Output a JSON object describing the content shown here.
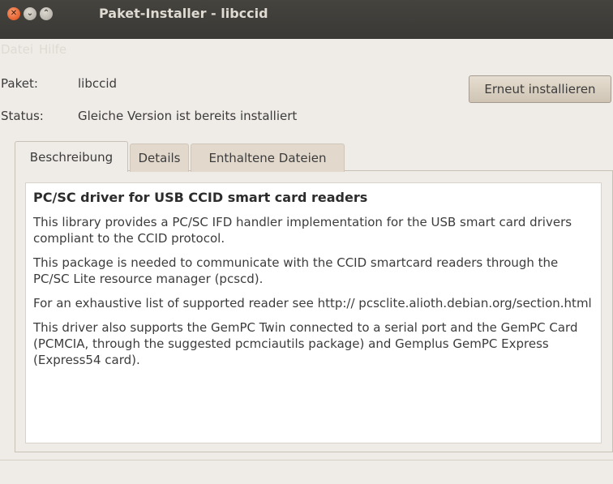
{
  "window": {
    "title": "Paket-Installer - libccid",
    "close_glyph": "✕",
    "minimize_glyph": "⌄",
    "maximize_glyph": "⌃"
  },
  "menu": [
    "Datei",
    "Hilfe"
  ],
  "package": {
    "label": "Paket:",
    "value": "libccid",
    "status_label": "Status:",
    "status_value": "Gleiche Version ist bereits installiert"
  },
  "reinstall_button": "Erneut installieren",
  "tabs": [
    "Beschreibung",
    "Details",
    "Enthaltene Dateien"
  ],
  "description": {
    "title": "PC/SC driver for USB CCID smart card readers",
    "paragraphs": [
      "This library provides a PC/SC IFD handler implementation for the USB smart card drivers compliant to the CCID protocol.",
      "This package is needed to communicate with the CCID smartcard readers through the PC/SC Lite resource manager (pcscd).",
      "For an exhaustive list of supported reader see http:// pcsclite.alioth.debian.org/section.html",
      "This driver also supports the GemPC Twin connected to a serial port and the GemPC Card (PCMCIA, through the suggested pcmciautils package) and Gemplus GemPC Express (Express54 card)."
    ]
  },
  "colors": {
    "titlebar": "#3a3935",
    "close_button": "#df4a16",
    "window_bg": "#efebe7"
  }
}
